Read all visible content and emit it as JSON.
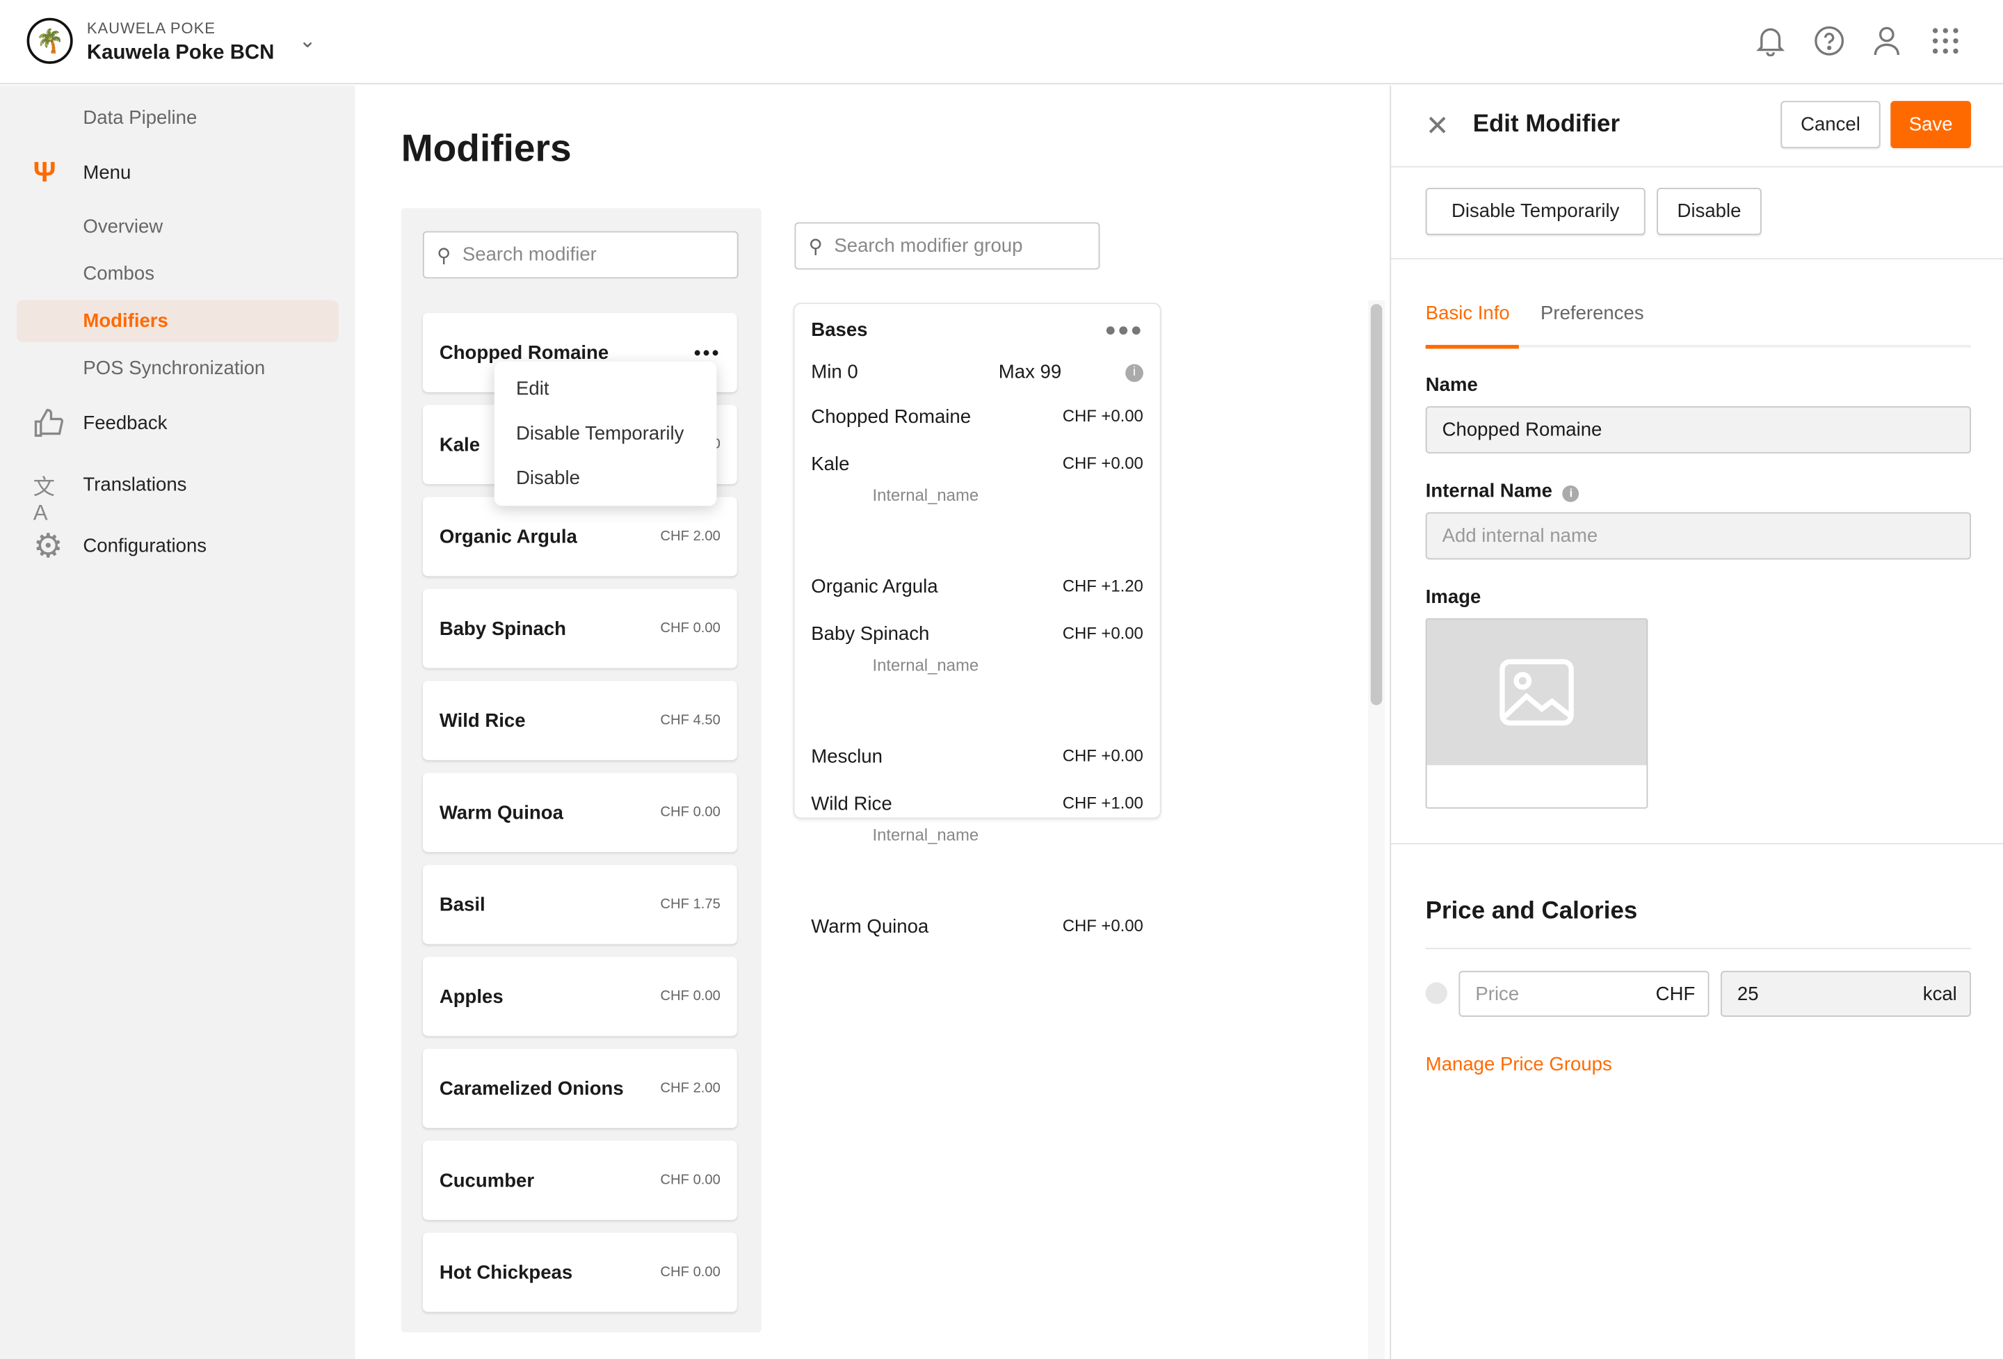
{
  "colors": {
    "accent": "#ff6a00",
    "active_bg": "#f2e6e1"
  },
  "header": {
    "org_small": "KAUWELA POKE",
    "org_name": "Kauwela Poke BCN",
    "icons": [
      "bell-icon",
      "help-icon",
      "user-icon",
      "apps-grid-icon"
    ]
  },
  "sidebar": {
    "data_pipeline": "Data Pipeline",
    "menu": "Menu",
    "overview": "Overview",
    "combos": "Combos",
    "modifiers": "Modifiers",
    "pos_sync": "POS Synchronization",
    "feedback": "Feedback",
    "translations": "Translations",
    "configurations": "Configurations"
  },
  "main": {
    "title": "Modifiers",
    "search_placeholder": "Search modifier",
    "group_search_placeholder": "Search modifier group",
    "modifiers": [
      {
        "name": "Chopped Romaine",
        "price": ""
      },
      {
        "name": "Kale",
        "price": "CHF 0.00"
      },
      {
        "name": "Organic Argula",
        "price": "CHF 2.00"
      },
      {
        "name": "Baby Spinach",
        "price": "CHF 0.00"
      },
      {
        "name": "Wild Rice",
        "price": "CHF 4.50"
      },
      {
        "name": "Warm Quinoa",
        "price": "CHF 0.00"
      },
      {
        "name": "Basil",
        "price": "CHF 1.75"
      },
      {
        "name": "Apples",
        "price": "CHF 0.00"
      },
      {
        "name": "Caramelized Onions",
        "price": "CHF 2.00"
      },
      {
        "name": "Cucumber",
        "price": "CHF 0.00"
      },
      {
        "name": "Hot Chickpeas",
        "price": "CHF 0.00"
      }
    ],
    "context_menu": [
      "Edit",
      "Disable Temporarily",
      "Disable"
    ],
    "group": {
      "name": "Bases",
      "min": "Min 0",
      "max": "Max 99",
      "items": [
        {
          "name": "Chopped Romaine",
          "price": "CHF +0.00",
          "internal": ""
        },
        {
          "name": "Kale",
          "price": "CHF +0.00",
          "internal": "Internal_name"
        },
        {
          "name": "Organic Argula",
          "price": "CHF +1.20",
          "internal": ""
        },
        {
          "name": "Baby Spinach",
          "price": "CHF +0.00",
          "internal": "Internal_name"
        },
        {
          "name": "Mesclun",
          "price": "CHF +0.00",
          "internal": ""
        },
        {
          "name": "Wild Rice",
          "price": "CHF +1.00",
          "internal": "Internal_name"
        },
        {
          "name": "Warm Quinoa",
          "price": "CHF +0.00",
          "internal": ""
        }
      ]
    }
  },
  "panel": {
    "title": "Edit Modifier",
    "cancel": "Cancel",
    "save": "Save",
    "disable_temp": "Disable Temporarily",
    "disable": "Disable",
    "tabs": [
      "Basic Info",
      "Preferences"
    ],
    "active_tab": "Basic Info",
    "name_label": "Name",
    "name_value": "Chopped Romaine",
    "internal_label": "Internal Name",
    "internal_placeholder": "Add internal name",
    "image_label": "Image",
    "price_section": "Price and Calories",
    "price_placeholder": "Price",
    "currency": "CHF",
    "calories": "25",
    "calories_unit": "kcal",
    "manage_link": "Manage Price Groups"
  }
}
